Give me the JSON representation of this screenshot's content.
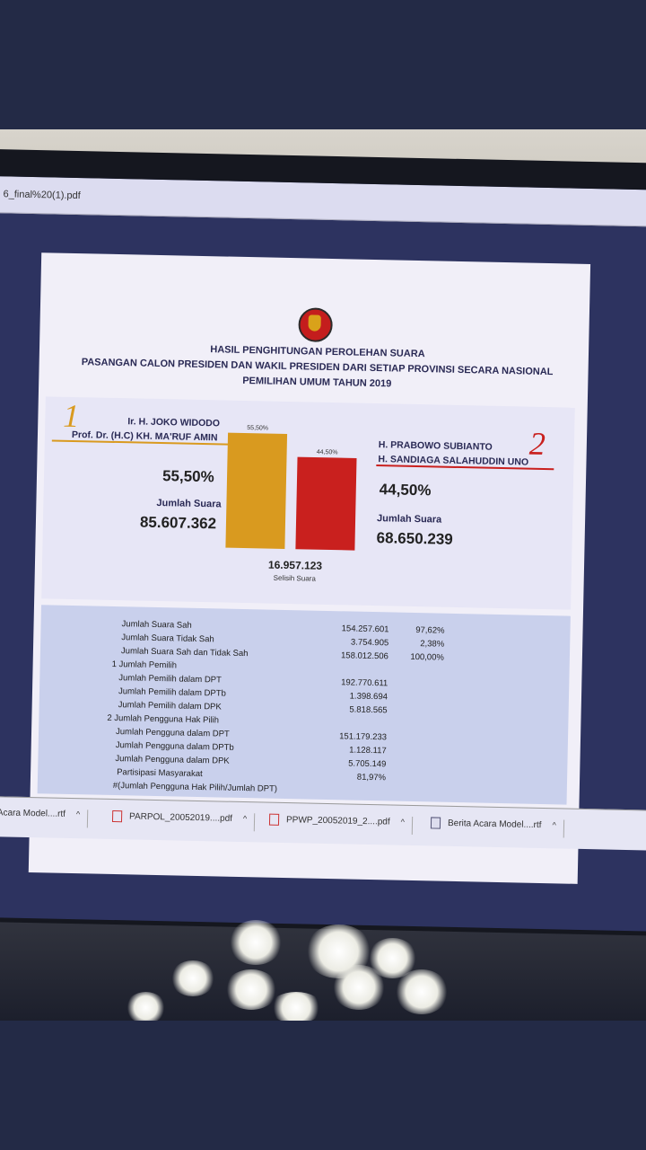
{
  "window": {
    "file_name": "6_final%20(1).pdf"
  },
  "document": {
    "heading_line1": "HASIL PENGHITUNGAN PEROLEHAN SUARA",
    "heading_line2": "PASANGAN CALON PRESIDEN DAN WAKIL PRESIDEN DARI SETIAP PROVINSI SECARA NASIONAL",
    "heading_line3": "PEMILIHAN UMUM TAHUN 2019",
    "candidate1": {
      "number": "1",
      "name1": "Ir. H. JOKO WIDODO",
      "name2": "Prof. Dr. (H.C) KH. MA'RUF AMIN",
      "percent": "55,50%",
      "votes_label": "Jumlah Suara",
      "votes": "85.607.362"
    },
    "candidate2": {
      "number": "2",
      "name1": "H. PRABOWO SUBIANTO",
      "name2": "H. SANDIAGA SALAHUDDIN UNO",
      "percent": "44,50%",
      "votes_label": "Jumlah Suara",
      "votes": "68.650.239"
    },
    "difference": {
      "value": "16.957.123",
      "label": "Selisih Suara"
    }
  },
  "chart_data": {
    "type": "bar",
    "categories": [
      "1",
      "2"
    ],
    "values": [
      55.5,
      44.5
    ],
    "data_labels": [
      "55,50%",
      "44,50%"
    ],
    "colors": [
      "#d99a1f",
      "#c9201e"
    ],
    "ylim": [
      0,
      55.5
    ],
    "title": "",
    "xlabel": "",
    "ylabel": ""
  },
  "stats": [
    {
      "label": "Jumlah Suara Sah",
      "value": "154.257.601",
      "pct": "97,62%"
    },
    {
      "label": "Jumlah Suara Tidak Sah",
      "value": "3.754.905",
      "pct": "2,38%"
    },
    {
      "label": "Jumlah Suara Sah dan Tidak Sah",
      "value": "158.012.506",
      "pct": "100,00%"
    },
    {
      "label": "1 Jumlah Pemilih",
      "value": "",
      "pct": ""
    },
    {
      "label": "Jumlah Pemilih dalam DPT",
      "value": "192.770.611",
      "pct": ""
    },
    {
      "label": "Jumlah Pemilih dalam DPTb",
      "value": "1.398.694",
      "pct": ""
    },
    {
      "label": "Jumlah Pemilih dalam DPK",
      "value": "5.818.565",
      "pct": ""
    },
    {
      "label": "2 Jumlah Pengguna Hak Pilih",
      "value": "",
      "pct": ""
    },
    {
      "label": "Jumlah Pengguna dalam DPT",
      "value": "151.179.233",
      "pct": ""
    },
    {
      "label": "Jumlah Pengguna dalam DPTb",
      "value": "1.128.117",
      "pct": ""
    },
    {
      "label": "Jumlah Pengguna dalam DPK",
      "value": "5.705.149",
      "pct": ""
    },
    {
      "label": "Partisipasi Masyarakat",
      "value": "81,97%",
      "pct": ""
    },
    {
      "label": "#(Jumlah Pengguna Hak Pilih/Jumlah DPT)",
      "value": "",
      "pct": ""
    }
  ],
  "taskbar": {
    "items": [
      {
        "label": "erita Acara Model....rtf",
        "icon": "doc-icon"
      },
      {
        "label": "PARPOL_20052019....pdf",
        "icon": "pdf-icon"
      },
      {
        "label": "PPWP_20052019_2....pdf",
        "icon": "pdf-icon"
      },
      {
        "label": "Berita Acara Model....rtf",
        "icon": "doc-icon"
      }
    ],
    "chevron": "^"
  }
}
